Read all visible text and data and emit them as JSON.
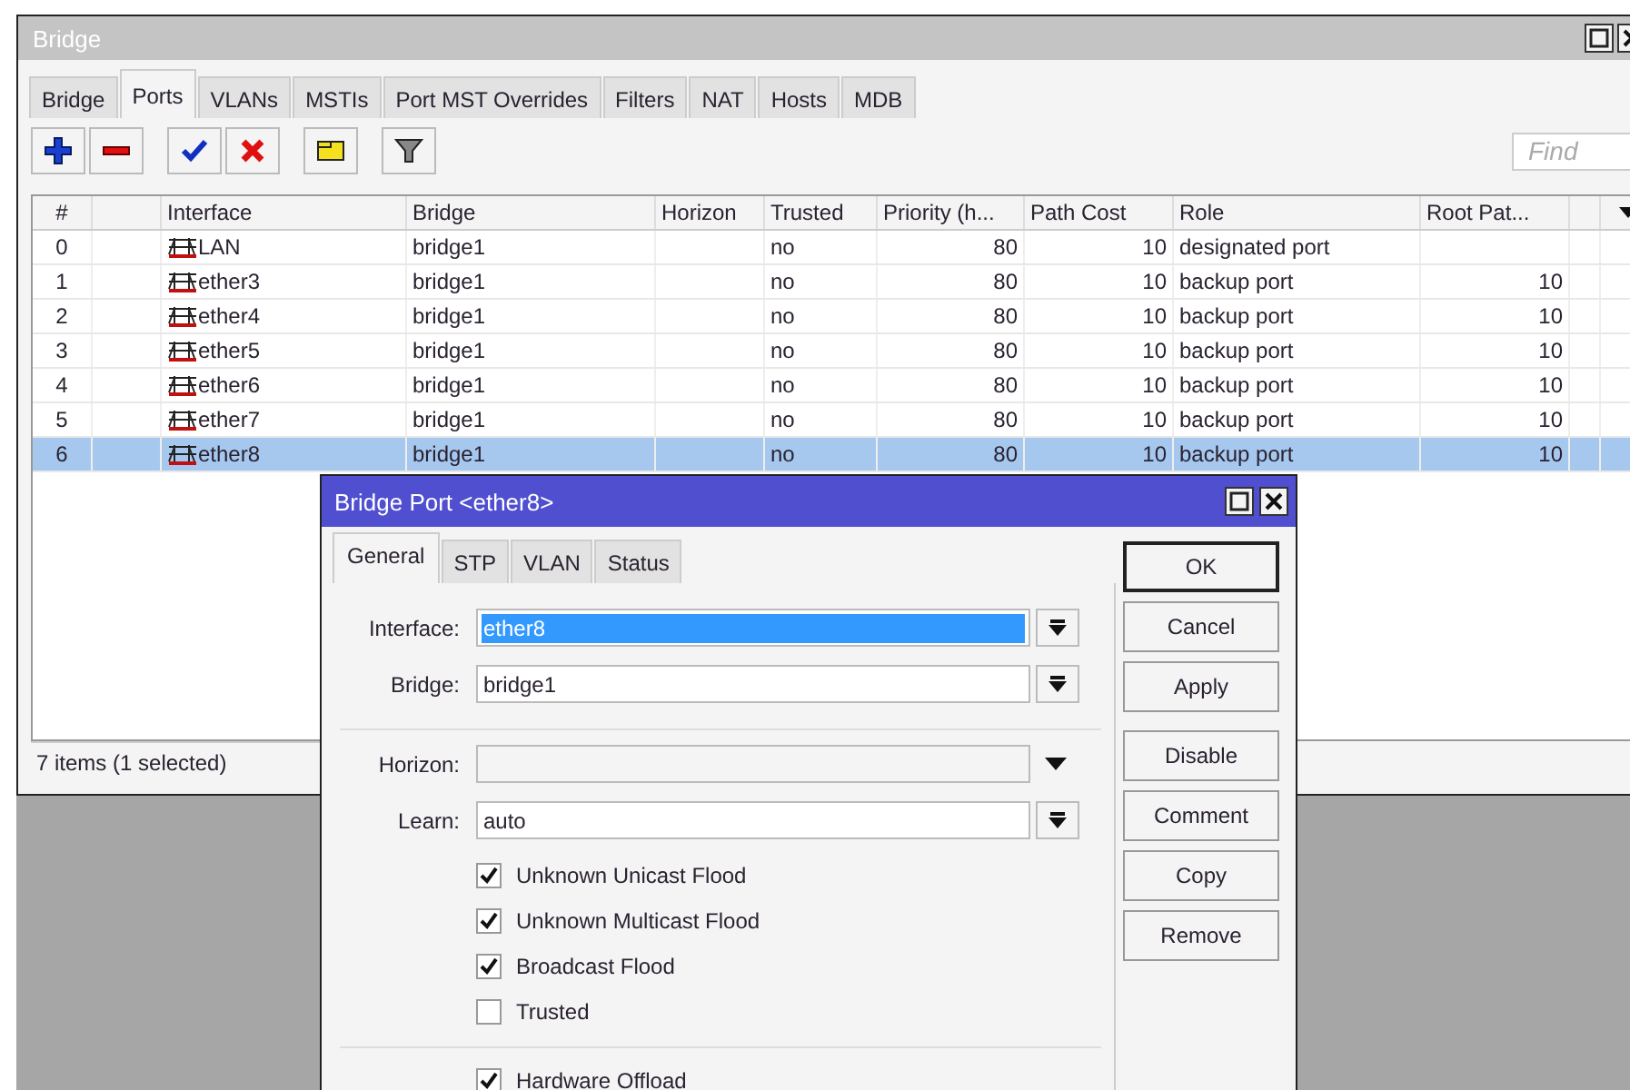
{
  "window": {
    "title": "Bridge"
  },
  "tabs": [
    {
      "label": "Bridge",
      "selected": false
    },
    {
      "label": "Ports",
      "selected": true
    },
    {
      "label": "VLANs",
      "selected": false
    },
    {
      "label": "MSTIs",
      "selected": false
    },
    {
      "label": "Port MST Overrides",
      "selected": false
    },
    {
      "label": "Filters",
      "selected": false
    },
    {
      "label": "NAT",
      "selected": false
    },
    {
      "label": "Hosts",
      "selected": false
    },
    {
      "label": "MDB",
      "selected": false
    }
  ],
  "find": {
    "placeholder": "Find"
  },
  "table": {
    "columns": [
      "#",
      "Interface",
      "Bridge",
      "Horizon",
      "Trusted",
      "Priority (h...",
      "Path Cost",
      "Role",
      "Root Pat..."
    ],
    "rows": [
      {
        "number": "0",
        "interface": "LAN",
        "bridge": "bridge1",
        "trusted": "no",
        "priority": "80",
        "path_cost": "10",
        "role": "designated port",
        "selected": false
      },
      {
        "number": "1",
        "interface": "ether3",
        "bridge": "bridge1",
        "trusted": "no",
        "priority": "80",
        "path_cost": "10",
        "role": "backup port",
        "root_path_cost": "10",
        "selected": false
      },
      {
        "number": "2",
        "interface": "ether4",
        "bridge": "bridge1",
        "trusted": "no",
        "priority": "80",
        "path_cost": "10",
        "role": "backup port",
        "root_path_cost": "10",
        "selected": false
      },
      {
        "number": "3",
        "interface": "ether5",
        "bridge": "bridge1",
        "trusted": "no",
        "priority": "80",
        "path_cost": "10",
        "role": "backup port",
        "root_path_cost": "10",
        "selected": false
      },
      {
        "number": "4",
        "interface": "ether6",
        "bridge": "bridge1",
        "trusted": "no",
        "priority": "80",
        "path_cost": "10",
        "role": "backup port",
        "root_path_cost": "10",
        "selected": false
      },
      {
        "number": "5",
        "interface": "ether7",
        "bridge": "bridge1",
        "trusted": "no",
        "priority": "80",
        "path_cost": "10",
        "role": "backup port",
        "root_path_cost": "10",
        "selected": false
      },
      {
        "number": "6",
        "interface": "ether8",
        "bridge": "bridge1",
        "trusted": "no",
        "priority": "80",
        "path_cost": "10",
        "role": "backup port",
        "root_path_cost": "10",
        "selected": true
      }
    ]
  },
  "status_bar": "7 items (1 selected)",
  "dialog": {
    "title": "Bridge Port <ether8>",
    "tabs": [
      {
        "label": "General",
        "selected": true
      },
      {
        "label": "STP",
        "selected": false
      },
      {
        "label": "VLAN",
        "selected": false
      },
      {
        "label": "Status",
        "selected": false
      }
    ],
    "sections": [
      {
        "fields": [
          {
            "label": "Interface:",
            "value": "ether8",
            "kind": "combo",
            "highlighted": true
          },
          {
            "label": "Bridge:",
            "value": "bridge1",
            "kind": "combo",
            "highlighted": false
          }
        ]
      },
      {
        "fields": [
          {
            "label": "Horizon:",
            "kind": "select"
          },
          {
            "label": "Learn:",
            "value": "auto",
            "kind": "combo",
            "highlighted": false
          }
        ],
        "checkboxes": [
          {
            "label": "Unknown Unicast Flood",
            "checked": true
          },
          {
            "label": "Unknown Multicast Flood",
            "checked": true
          },
          {
            "label": "Broadcast Flood",
            "checked": true
          },
          {
            "label": "Trusted",
            "checked": false
          }
        ]
      },
      {
        "checkboxes": [
          {
            "label": "Hardware Offload",
            "checked": true
          }
        ]
      }
    ],
    "button_groups": [
      [
        {
          "label": "OK",
          "default": true
        },
        {
          "label": "Cancel",
          "default": false
        },
        {
          "label": "Apply",
          "default": false
        }
      ],
      [
        {
          "label": "Disable",
          "default": false
        },
        {
          "label": "Comment",
          "default": false
        },
        {
          "label": "Copy",
          "default": false
        },
        {
          "label": "Remove",
          "default": false
        }
      ]
    ]
  }
}
